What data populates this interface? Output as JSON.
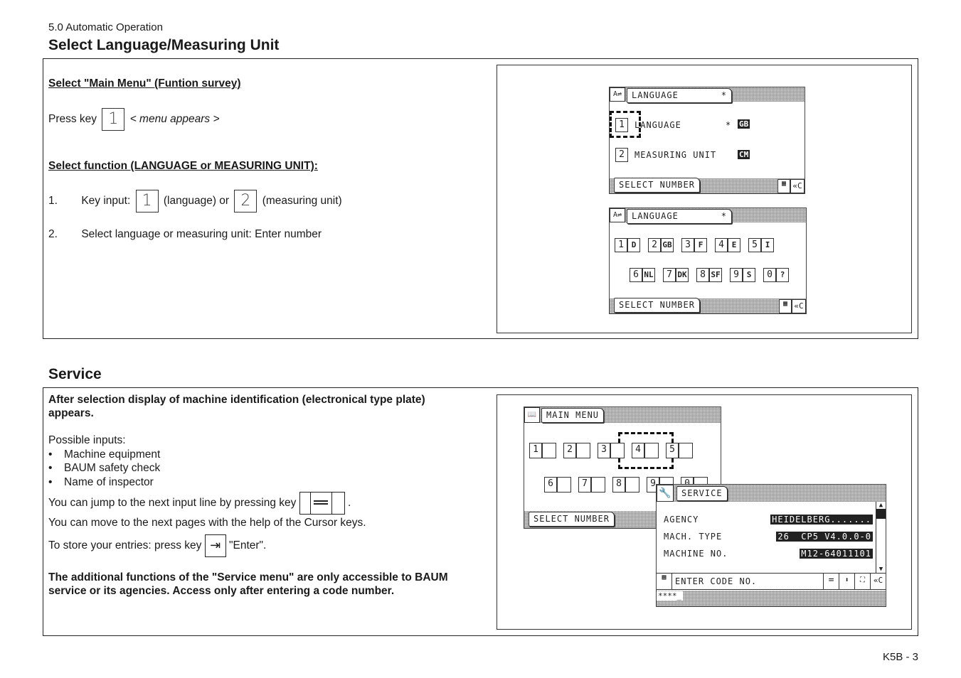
{
  "header": {
    "chapter": "5.0 Automatic Operation",
    "title": "Select Language/Measuring Unit"
  },
  "section1": {
    "heading1": "Select \"Main Menu\" (Funtion survey)",
    "press_key_prefix": "Press key",
    "press_key_value": "1",
    "press_key_suffix": "< menu appears >",
    "heading2": "Select function (LANGUAGE or MEASURING UNIT):",
    "step1_num": "1.",
    "step1_prefix": "Key input:",
    "step1_key1": "1",
    "step1_mid": "(language) or",
    "step1_key2": "2",
    "step1_suffix": "(measuring unit)",
    "step2_num": "2.",
    "step2_text": "Select language or measuring unit: Enter number"
  },
  "lcd1": {
    "title": "LANGUAGE",
    "star": "*",
    "rows": [
      {
        "num": "1",
        "label": "LANGUAGE",
        "star": "*",
        "value": "GB"
      },
      {
        "num": "2",
        "label": "MEASURING UNIT",
        "star": "",
        "value": "CM"
      }
    ],
    "footer": "SELECT NUMBER",
    "clear": "«C"
  },
  "lcd2": {
    "title": "LANGUAGE",
    "star": "*",
    "options_row1": [
      {
        "num": "1",
        "code": "D"
      },
      {
        "num": "2",
        "code": "GB"
      },
      {
        "num": "3",
        "code": "F"
      },
      {
        "num": "4",
        "code": "E"
      },
      {
        "num": "5",
        "code": "I"
      }
    ],
    "options_row2": [
      {
        "num": "6",
        "code": "NL"
      },
      {
        "num": "7",
        "code": "DK"
      },
      {
        "num": "8",
        "code": "SF"
      },
      {
        "num": "9",
        "code": "S"
      },
      {
        "num": "0",
        "code": "?"
      }
    ],
    "footer": "SELECT NUMBER",
    "clear": "«C"
  },
  "section2": {
    "title": "Service",
    "intro": "After selection display of machine identification (electronical type plate) appears.",
    "possible_inputs_label": "Possible inputs:",
    "inputs": [
      "Machine equipment",
      "BAUM safety check",
      "Name of inspector"
    ],
    "jump_text": "You can jump to the next input line by pressing key",
    "jump_key": "=",
    "cursor_text": "You can move to the next pages with the help of the Cursor keys.",
    "store_prefix": "To store your entries: press key",
    "store_suffix": "\"Enter\".",
    "note": "The additional functions of  the \"Service menu\" are only accessible to BAUM service or its agencies. Access only after entering a code number."
  },
  "lcd3": {
    "title": "MAIN MENU",
    "row1": [
      "1",
      "2",
      "3",
      "4",
      "5"
    ],
    "row2": [
      "6",
      "7",
      "8",
      "9",
      "0"
    ],
    "footer": "SELECT NUMBER"
  },
  "lcd4": {
    "title": "SERVICE",
    "fields": [
      {
        "label": "AGENCY",
        "value": "HEIDELBERG......."
      },
      {
        "label": "MACH. TYPE",
        "value": "26  CP5 V4.0.0-0"
      },
      {
        "label": "MACHINE NO.",
        "value": "M12-64011101"
      }
    ],
    "prompt": "ENTER CODE NO.",
    "equals": "=",
    "clear": "«C",
    "input_value": "****_"
  },
  "page_footer": "K5B - 3"
}
